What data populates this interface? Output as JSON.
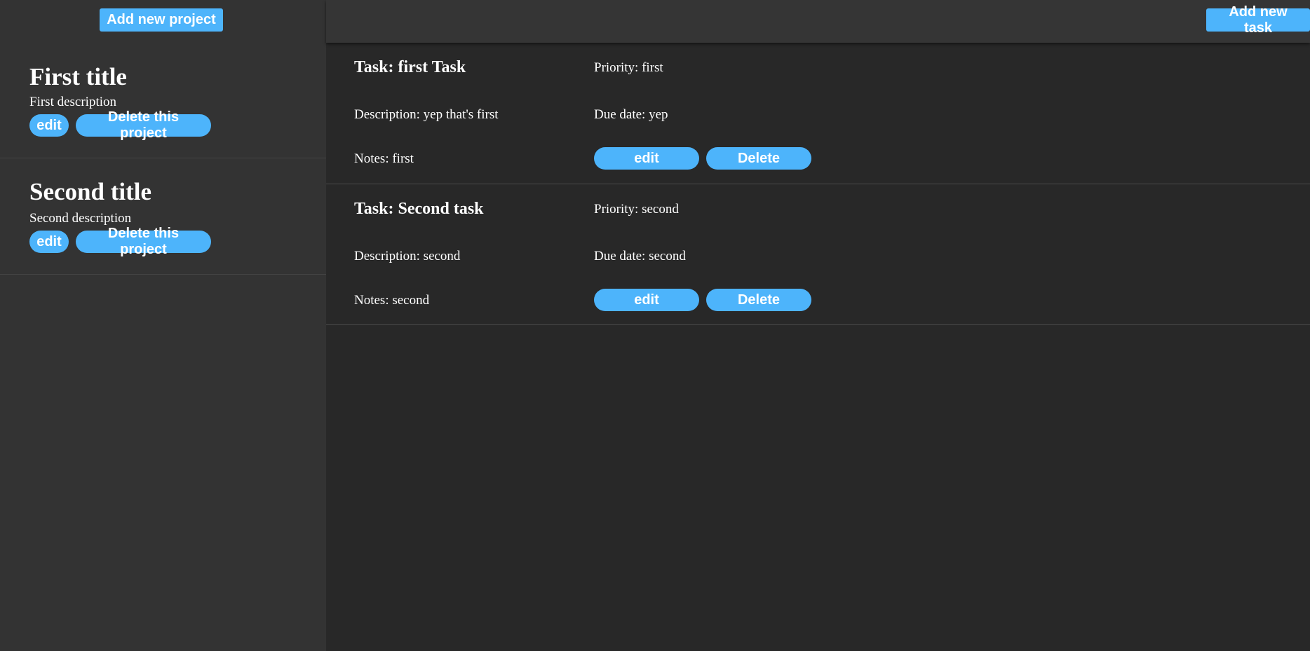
{
  "sidebar": {
    "add_project_label": "Add new project",
    "projects": [
      {
        "title": "First title",
        "description": "First description",
        "edit_label": "edit",
        "delete_label": "Delete this project"
      },
      {
        "title": "Second title",
        "description": "Second description",
        "edit_label": "edit",
        "delete_label": "Delete this project"
      }
    ]
  },
  "main": {
    "add_task_label": "Add new task",
    "tasks": [
      {
        "title": "Task: first Task",
        "priority": "Priority: first",
        "description": "Description: yep that's first",
        "due_date": "Due date: yep",
        "notes": "Notes: first",
        "edit_label": "edit",
        "delete_label": "Delete"
      },
      {
        "title": "Task: Second task",
        "priority": "Priority: second",
        "description": "Description: second",
        "due_date": "Due date: second",
        "notes": "Notes: second",
        "edit_label": "edit",
        "delete_label": "Delete"
      }
    ]
  },
  "colors": {
    "accent": "#4db4fb",
    "sidebar_bg": "#333333",
    "main_bg": "#282828",
    "header_bg": "#353535",
    "text": "#ffffff"
  }
}
